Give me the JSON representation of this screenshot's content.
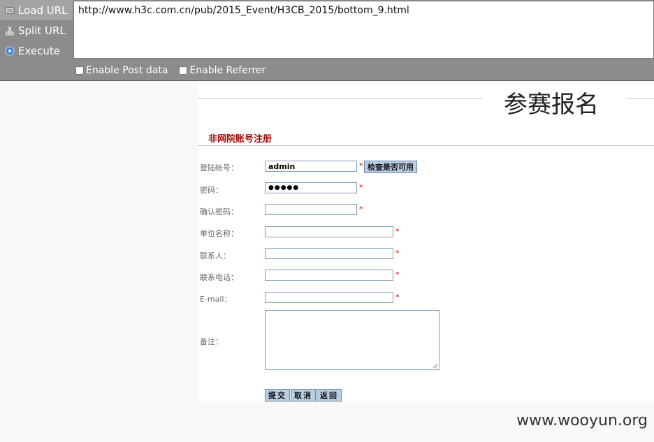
{
  "hackbar": {
    "menu": [
      {
        "label": "Load URL",
        "icon": "load-url-icon"
      },
      {
        "label": "Split URL",
        "icon": "split-url-icon"
      },
      {
        "label": "Execute",
        "icon": "execute-icon"
      }
    ],
    "url_value": "http://www.h3c.com.cn/pub/2015_Event/H3CB_2015/bottom_9.html",
    "options": {
      "post_label": "Enable Post data",
      "referrer_label": "Enable Referrer"
    }
  },
  "page": {
    "heading": "参赛报名",
    "section_title": "非网院账号注册",
    "form": {
      "account_label": "登陆帐号：",
      "account_value": "admin",
      "check_button": "检查是否可用",
      "password_label": "密码：",
      "password_value": "●●●●●",
      "confirm_label": "确认密码：",
      "unit_label": "单位名称：",
      "contact_label": "联系人：",
      "phone_label": "联系电话：",
      "email_label": "E-mail：",
      "notes_label": "备注：",
      "required_mark": "*"
    },
    "buttons": {
      "submit": "提交",
      "cancel": "取消",
      "back": "返回"
    }
  },
  "watermark": "www.wooyun.org",
  "colors": {
    "hackbar_bg": "#8c8c8c",
    "section_title": "#a00a0a",
    "required": "#e00000",
    "button_bg": "#b9cde3"
  }
}
